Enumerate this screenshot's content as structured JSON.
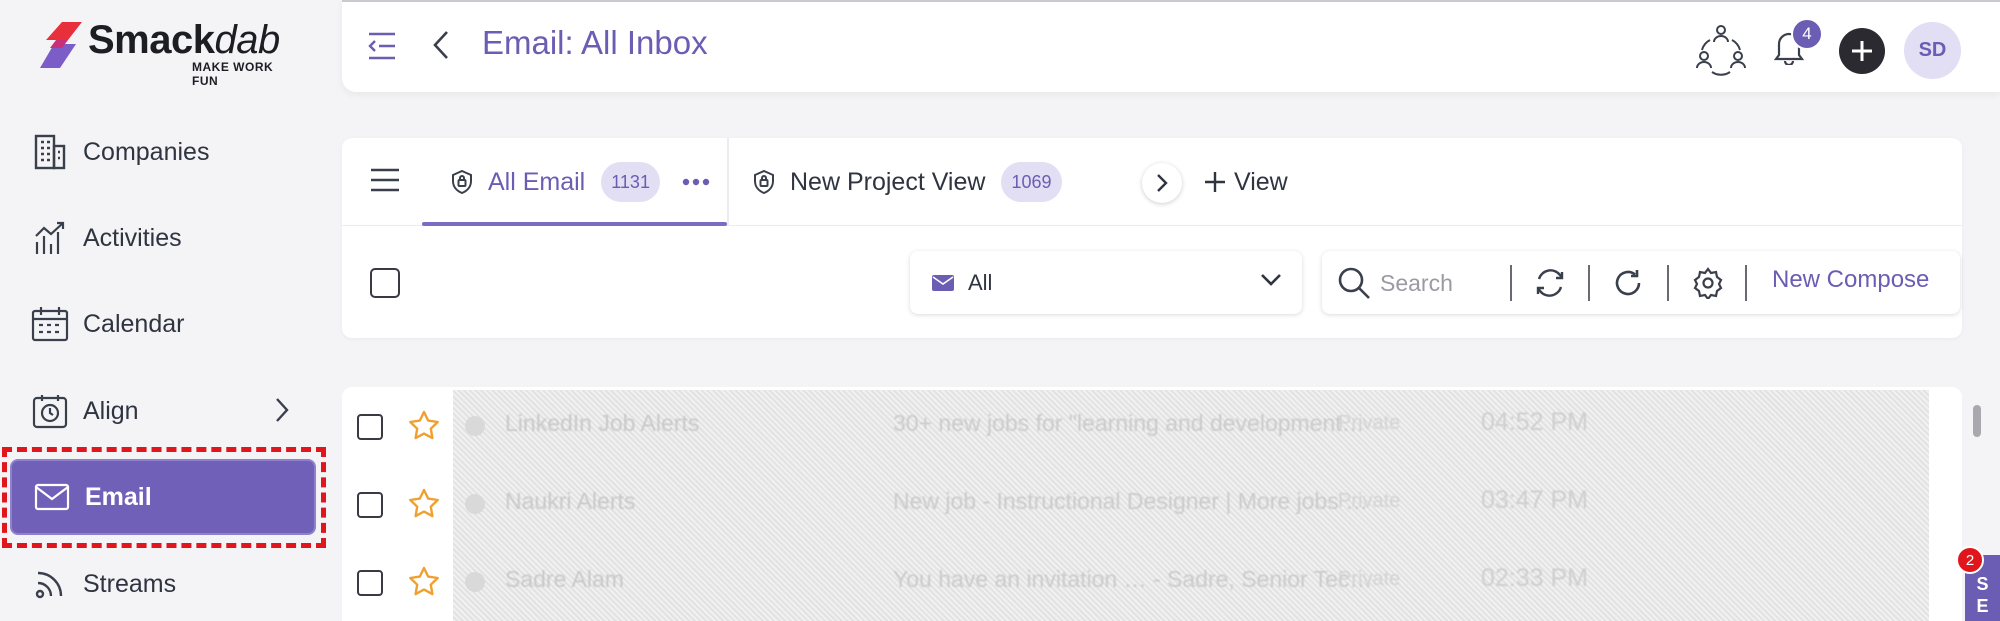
{
  "brand": {
    "name_bold": "Smack",
    "name_italic": "dab",
    "tagline": "MAKE WORK FUN",
    "accent": "#6b5db3",
    "logo_red": "#e8303d"
  },
  "sidebar": {
    "items": [
      {
        "label": "Companies",
        "icon": "building-icon"
      },
      {
        "label": "Activities",
        "icon": "activities-chart-icon"
      },
      {
        "label": "Calendar",
        "icon": "calendar-icon"
      },
      {
        "label": "Align",
        "icon": "clock-calendar-icon"
      },
      {
        "label": "Email",
        "icon": "mail-icon"
      },
      {
        "label": "Streams",
        "icon": "stream-icon"
      }
    ],
    "active_bg": "#7060b8",
    "highlight_color": "#e0161c"
  },
  "header": {
    "title": "Email: All Inbox",
    "notification_count": "4",
    "avatar_initials": "SD"
  },
  "views": {
    "tabs": [
      {
        "label": "All Email",
        "count": "1131"
      },
      {
        "label": "New  Project View",
        "count": "1069"
      }
    ],
    "add_view_label": "View"
  },
  "toolbar": {
    "filter_value": "All",
    "search_placeholder": "Search",
    "compose_label": "New Compose"
  },
  "emails": [
    {
      "sender": "LinkedIn Job Alerts",
      "subject": "30+ new jobs for \"learning and development…",
      "visibility": "Private",
      "time": "04:52 PM"
    },
    {
      "sender": "Naukri Alerts",
      "subject": "New job - Instructional Designer | More jobs …",
      "visibility": "Private",
      "time": "03:47 PM"
    },
    {
      "sender": "Sadre Alam",
      "subject": "You have an invitation … - Sadre, Senior Tec…",
      "visibility": "Private",
      "time": "02:33 PM"
    }
  ],
  "corner_widget": {
    "badge": "2",
    "letters": [
      "S",
      "E"
    ]
  }
}
